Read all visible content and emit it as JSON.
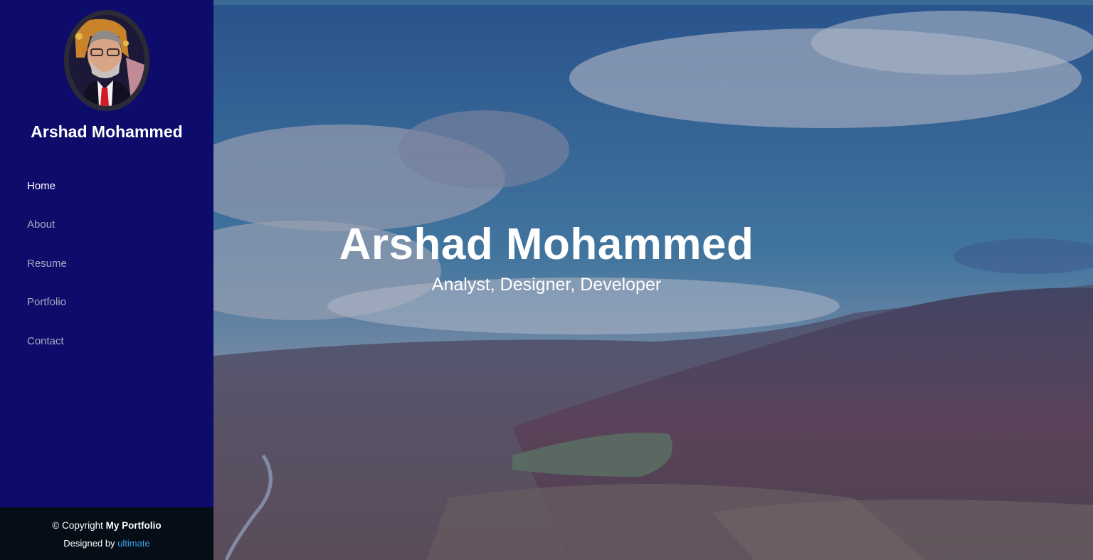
{
  "sidebar": {
    "name": "Arshad Mohammed",
    "nav": [
      {
        "label": "Home",
        "active": true
      },
      {
        "label": "About"
      },
      {
        "label": "Resume"
      },
      {
        "label": "Portfolio"
      },
      {
        "label": "Contact"
      }
    ],
    "footer": {
      "copyright_prefix": "© Copyright",
      "copyright_site": "My Portfolio",
      "designed_prefix": "Designed by",
      "designed_link": "ultimate"
    }
  },
  "hero": {
    "title": "Arshad Mohammed",
    "subtitle": "Analyst, Designer, Developer"
  },
  "colors": {
    "sidebar_bg": "#0e0c6b",
    "footer_bg": "#050d17",
    "link_accent": "#3ea2ea"
  }
}
